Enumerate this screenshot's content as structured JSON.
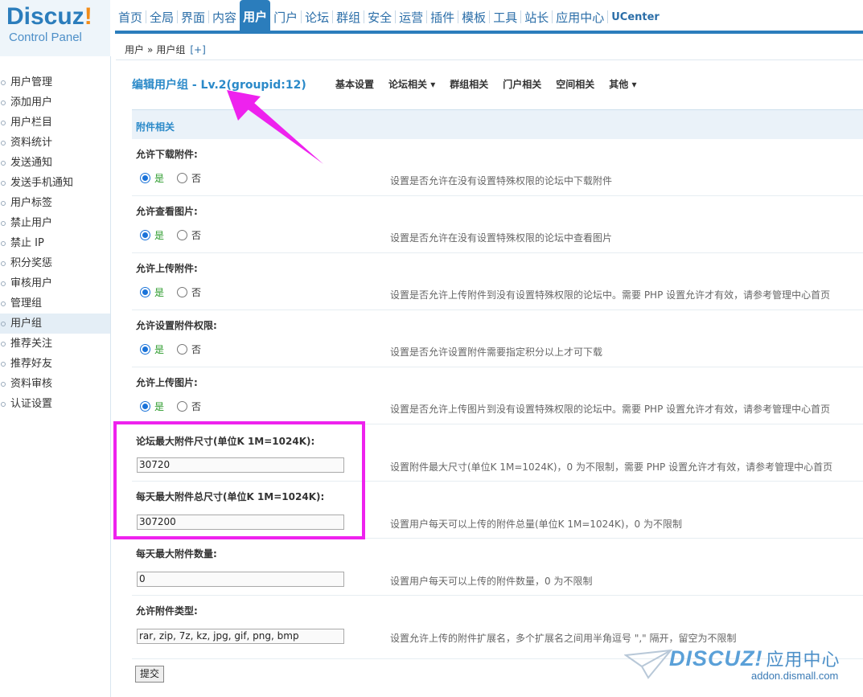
{
  "logo": {
    "brand": "Discuz",
    "bang": "!",
    "subtitle": "Control Panel"
  },
  "nav": {
    "items": [
      "首页",
      "全局",
      "界面",
      "内容",
      "用户",
      "门户",
      "论坛",
      "群组",
      "安全",
      "运营",
      "插件",
      "模板",
      "工具",
      "站长",
      "应用中心",
      "UCenter"
    ],
    "active": "用户"
  },
  "breadcrumb": {
    "part1": "用户",
    "sep": "»",
    "part2": "用户组",
    "plus": "[+]"
  },
  "sidebar": {
    "items": [
      "用户管理",
      "添加用户",
      "用户栏目",
      "资料统计",
      "发送通知",
      "发送手机通知",
      "用户标签",
      "禁止用户",
      "禁止 IP",
      "积分奖惩",
      "审核用户",
      "管理组",
      "用户组",
      "推荐关注",
      "推荐好友",
      "资料审核",
      "认证设置"
    ],
    "active": "用户组"
  },
  "main": {
    "title": "编辑用户组 - Lv.2(groupid:12)",
    "subnav": [
      "基本设置",
      "论坛相关 ▾",
      "群组相关",
      "门户相关",
      "空间相关",
      "其他 ▾"
    ],
    "section": "附件相关",
    "yes": "是",
    "no": "否",
    "rows": [
      {
        "label": "允许下载附件:",
        "desc": "设置是否允许在没有设置特殊权限的论坛中下载附件"
      },
      {
        "label": "允许查看图片:",
        "desc": "设置是否允许在没有设置特殊权限的论坛中查看图片"
      },
      {
        "label": "允许上传附件:",
        "desc": "设置是否允许上传附件到没有设置特殊权限的论坛中。需要 PHP 设置允许才有效，请参考管理中心首页"
      },
      {
        "label": "允许设置附件权限:",
        "desc": "设置是否允许设置附件需要指定积分以上才可下载"
      },
      {
        "label": "允许上传图片:",
        "desc": "设置是否允许上传图片到没有设置特殊权限的论坛中。需要 PHP 设置允许才有效，请参考管理中心首页"
      }
    ],
    "inputs": [
      {
        "label": "论坛最大附件尺寸(单位K 1M=1024K):",
        "value": "30720",
        "desc": "设置附件最大尺寸(单位K 1M=1024K)，0 为不限制，需要 PHP 设置允许才有效，请参考管理中心首页"
      },
      {
        "label": "每天最大附件总尺寸(单位K 1M=1024K):",
        "value": "307200",
        "desc": "设置用户每天可以上传的附件总量(单位K 1M=1024K)，0 为不限制"
      },
      {
        "label": "每天最大附件数量:",
        "value": "0",
        "desc": "设置用户每天可以上传的附件数量，0 为不限制"
      },
      {
        "label": "允许附件类型:",
        "value": "rar, zip, 7z, kz, jpg, gif, png, bmp",
        "desc": "设置允许上传的附件扩展名，多个扩展名之间用半角逗号 \",\" 隔开，留空为不限制"
      }
    ],
    "submit": "提交"
  },
  "watermark": {
    "brand": "DISCUZ!",
    "cn": "应用中心",
    "url": "addon.dismall.com"
  },
  "colors": {
    "accent": "#2b7dbc",
    "annotation": "#ee22ee"
  }
}
